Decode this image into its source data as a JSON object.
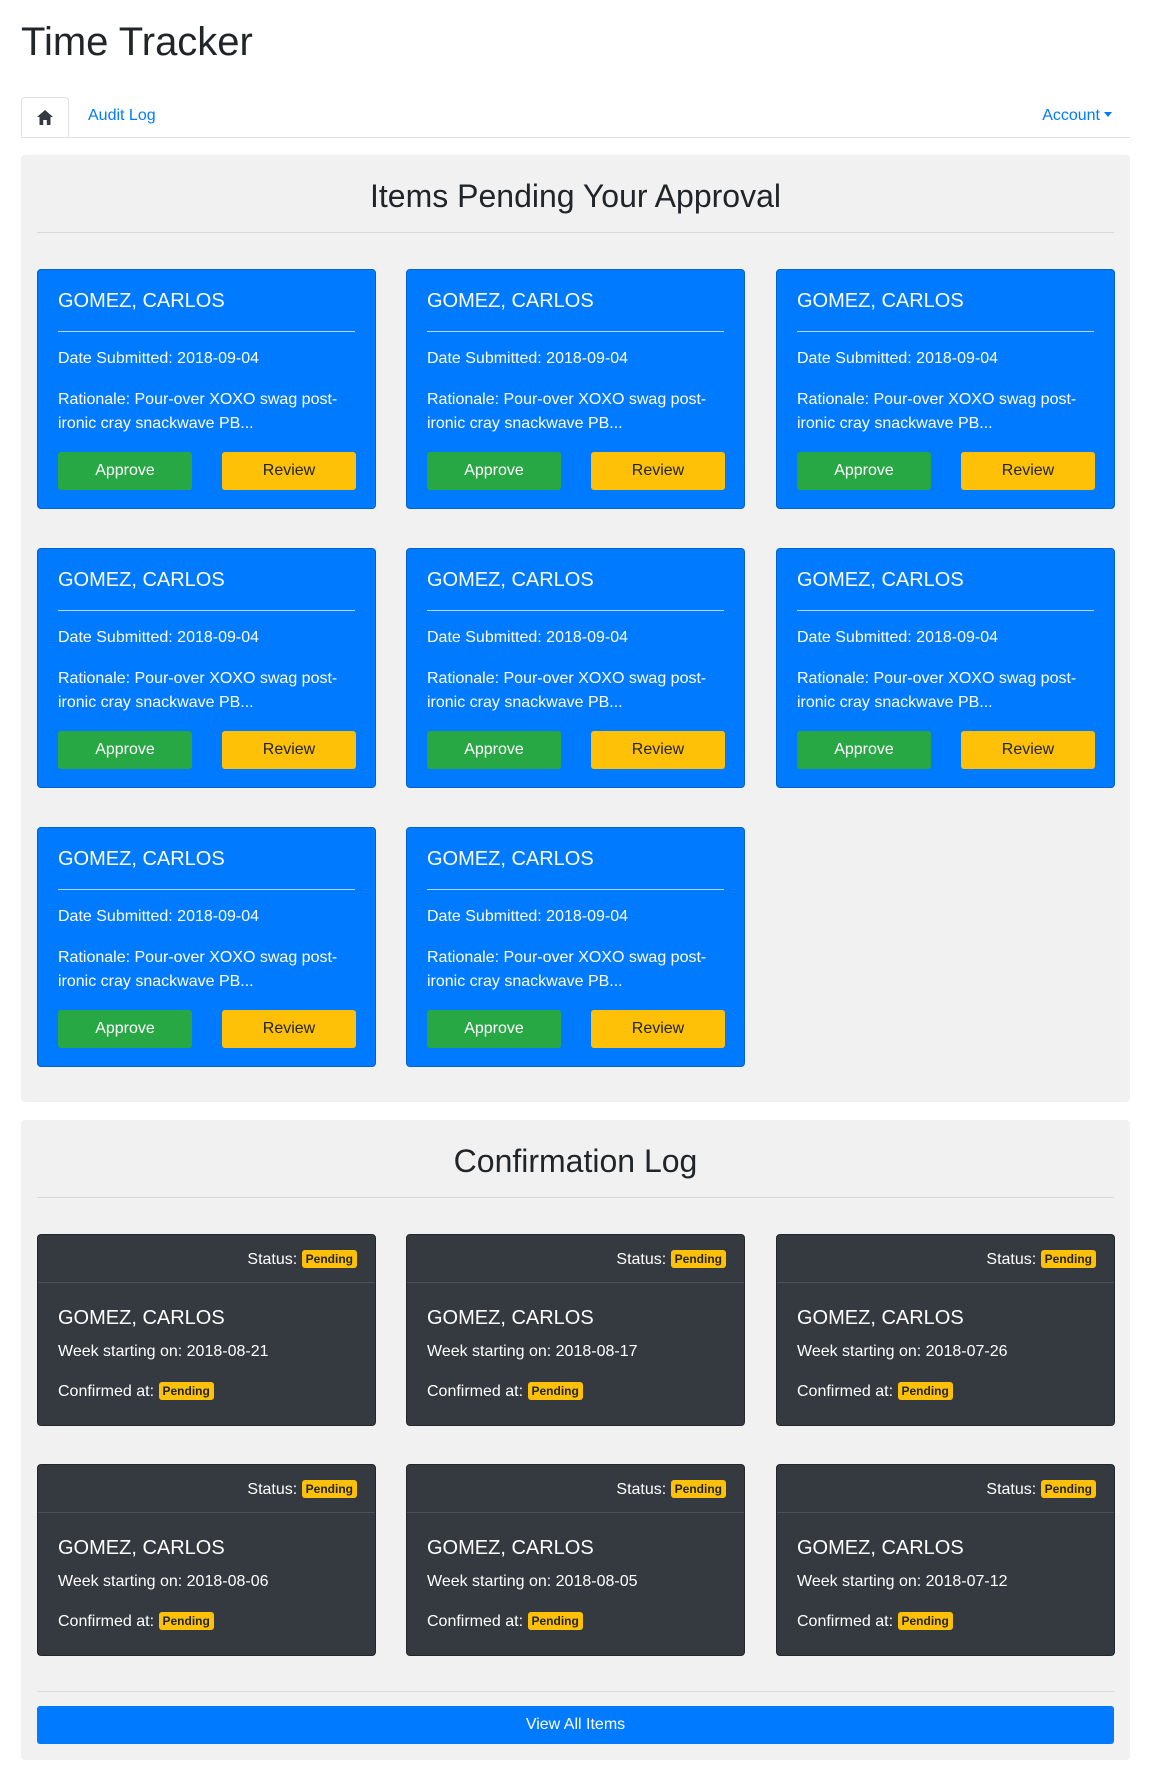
{
  "app": {
    "title": "Time Tracker"
  },
  "nav": {
    "home_icon": "home-icon",
    "audit_log": "Audit Log",
    "account": "Account"
  },
  "approval": {
    "title": "Items Pending Your Approval",
    "cards": [
      {
        "name": "GOMEZ, CARLOS",
        "date": "Date Submitted: 2018-09-04",
        "rationale": "Rationale: Pour-over XOXO swag post-ironic cray snackwave PB...",
        "approve": "Approve",
        "review": "Review"
      },
      {
        "name": "GOMEZ, CARLOS",
        "date": "Date Submitted: 2018-09-04",
        "rationale": "Rationale: Pour-over XOXO swag post-ironic cray snackwave PB...",
        "approve": "Approve",
        "review": "Review"
      },
      {
        "name": "GOMEZ, CARLOS",
        "date": "Date Submitted: 2018-09-04",
        "rationale": "Rationale: Pour-over XOXO swag post-ironic cray snackwave PB...",
        "approve": "Approve",
        "review": "Review"
      },
      {
        "name": "GOMEZ, CARLOS",
        "date": "Date Submitted: 2018-09-04",
        "rationale": "Rationale: Pour-over XOXO swag post-ironic cray snackwave PB...",
        "approve": "Approve",
        "review": "Review"
      },
      {
        "name": "GOMEZ, CARLOS",
        "date": "Date Submitted: 2018-09-04",
        "rationale": "Rationale: Pour-over XOXO swag post-ironic cray snackwave PB...",
        "approve": "Approve",
        "review": "Review"
      },
      {
        "name": "GOMEZ, CARLOS",
        "date": "Date Submitted: 2018-09-04",
        "rationale": "Rationale: Pour-over XOXO swag post-ironic cray snackwave PB...",
        "approve": "Approve",
        "review": "Review"
      },
      {
        "name": "GOMEZ, CARLOS",
        "date": "Date Submitted: 2018-09-04",
        "rationale": "Rationale: Pour-over XOXO swag post-ironic cray snackwave PB...",
        "approve": "Approve",
        "review": "Review"
      },
      {
        "name": "GOMEZ, CARLOS",
        "date": "Date Submitted: 2018-09-04",
        "rationale": "Rationale: Pour-over XOXO swag post-ironic cray snackwave PB...",
        "approve": "Approve",
        "review": "Review"
      }
    ]
  },
  "log": {
    "title": "Confirmation Log",
    "status_label": "Status:",
    "confirmed_label": "Confirmed at:",
    "cards": [
      {
        "status": "Pending",
        "name": "GOMEZ, CARLOS",
        "week": "Week starting on: 2018-08-21",
        "confirmed": "Pending"
      },
      {
        "status": "Pending",
        "name": "GOMEZ, CARLOS",
        "week": "Week starting on: 2018-08-17",
        "confirmed": "Pending"
      },
      {
        "status": "Pending",
        "name": "GOMEZ, CARLOS",
        "week": "Week starting on: 2018-07-26",
        "confirmed": "Pending"
      },
      {
        "status": "Pending",
        "name": "GOMEZ, CARLOS",
        "week": "Week starting on: 2018-08-06",
        "confirmed": "Pending"
      },
      {
        "status": "Pending",
        "name": "GOMEZ, CARLOS",
        "week": "Week starting on: 2018-08-05",
        "confirmed": "Pending"
      },
      {
        "status": "Pending",
        "name": "GOMEZ, CARLOS",
        "week": "Week starting on: 2018-07-12",
        "confirmed": "Pending"
      }
    ],
    "view_all": "View All Items"
  },
  "colors": {
    "primary": "#007bff",
    "success": "#28a745",
    "warning": "#ffc107",
    "dark": "#343a40",
    "panel_bg": "#f1f1f1"
  }
}
